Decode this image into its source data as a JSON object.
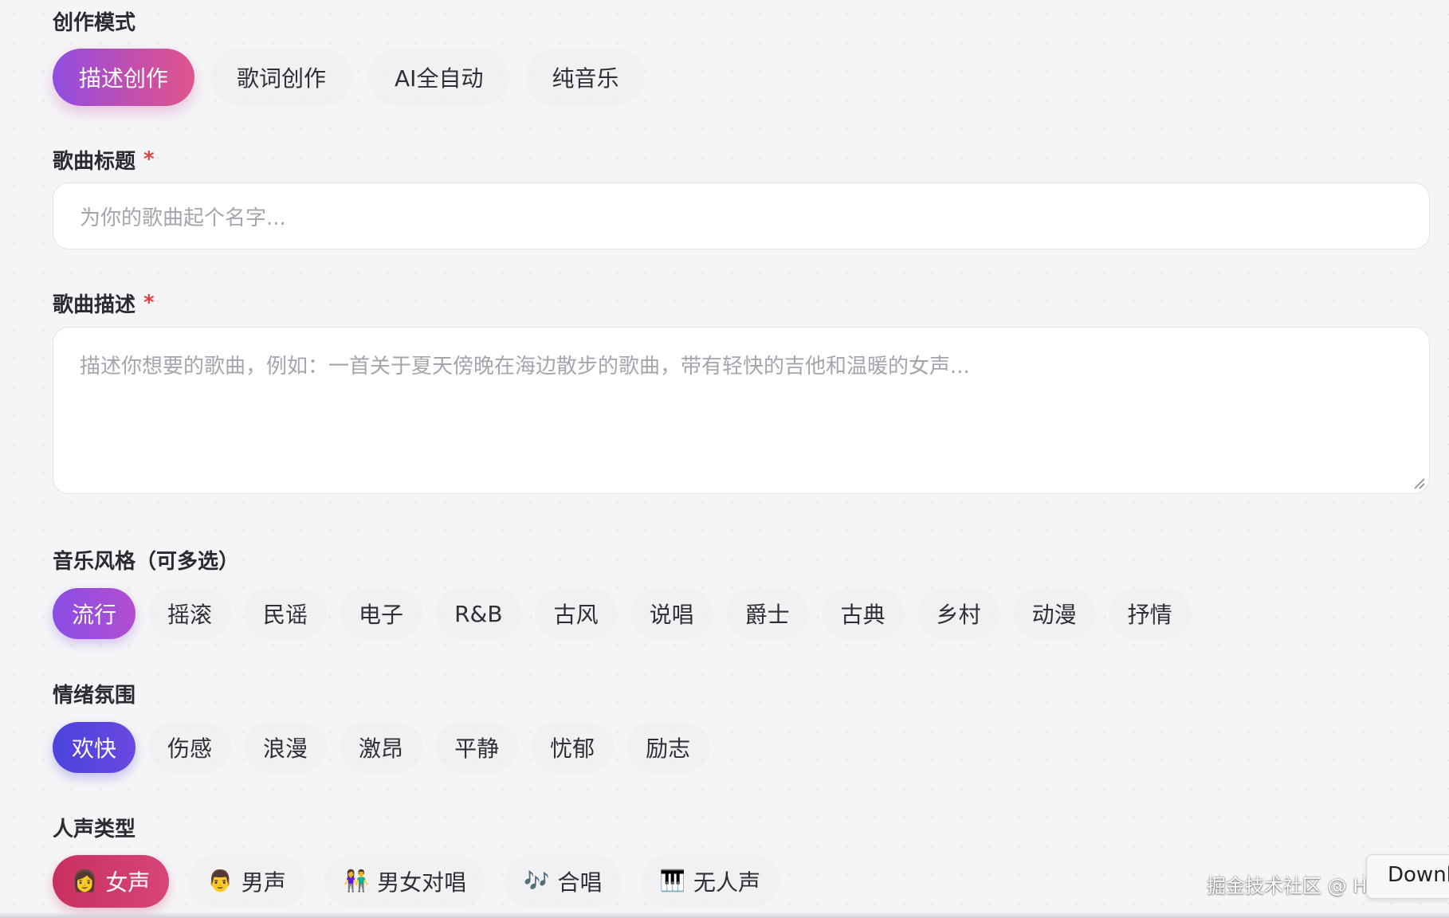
{
  "mode": {
    "label": "创作模式",
    "options": [
      "描述创作",
      "歌词创作",
      "AI全自动",
      "纯音乐"
    ],
    "active_index": 0
  },
  "title_field": {
    "label": "歌曲标题",
    "required_mark": "*",
    "placeholder": "为你的歌曲起个名字..."
  },
  "description_field": {
    "label": "歌曲描述",
    "required_mark": "*",
    "placeholder": "描述你想要的歌曲，例如：一首关于夏天傍晚在海边散步的歌曲，带有轻快的吉他和温暖的女声..."
  },
  "style": {
    "label": "音乐风格（可多选）",
    "options": [
      "流行",
      "摇滚",
      "民谣",
      "电子",
      "R&B",
      "古风",
      "说唱",
      "爵士",
      "古典",
      "乡村",
      "动漫",
      "抒情"
    ],
    "active_index": 0
  },
  "mood": {
    "label": "情绪氛围",
    "options": [
      "欢快",
      "伤感",
      "浪漫",
      "激昂",
      "平静",
      "忧郁",
      "励志"
    ],
    "active_index": 0
  },
  "voice": {
    "label": "人声类型",
    "options": [
      {
        "icon": "👩",
        "icon_name": "woman-icon",
        "label": "女声"
      },
      {
        "icon": "👨",
        "icon_name": "man-icon",
        "label": "男声"
      },
      {
        "icon": "👫",
        "icon_name": "couple-icon",
        "label": "男女对唱"
      },
      {
        "icon": "🎶",
        "icon_name": "music-notes-icon",
        "label": "合唱"
      },
      {
        "icon": "🎹",
        "icon_name": "piano-icon",
        "label": "无人声"
      }
    ],
    "active_index": 0
  },
  "overlay": {
    "watermark": "掘金技术社区 @ HBLOG",
    "download_tab": "Downl"
  },
  "colors": {
    "mode_active": "#8f4de3",
    "style_active": "#8a4de4",
    "mood_active": "#4a44dc",
    "voice_active": "#c8305e",
    "required": "#e0433d"
  }
}
